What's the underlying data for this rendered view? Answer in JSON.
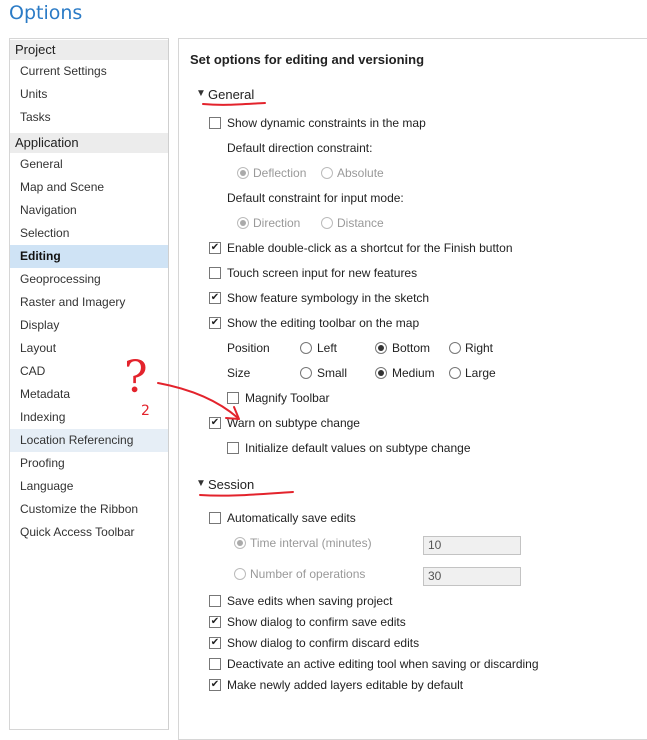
{
  "window": {
    "title": "Options"
  },
  "nav": {
    "groups": [
      {
        "label": "Project",
        "items": [
          "Current Settings",
          "Units",
          "Tasks"
        ]
      },
      {
        "label": "Application",
        "items": [
          "General",
          "Map and Scene",
          "Navigation",
          "Selection",
          "Editing",
          "Geoprocessing",
          "Raster and Imagery",
          "Display",
          "Layout",
          "CAD",
          "Metadata",
          "Indexing",
          "Location Referencing",
          "Proofing",
          "Language",
          "Customize the Ribbon",
          "Quick Access Toolbar"
        ]
      }
    ],
    "selected": "Editing",
    "hovered": "Location Referencing"
  },
  "panel": {
    "heading": "Set options for editing and versioning",
    "general": {
      "title": "General",
      "show_dynamic": {
        "label": "Show dynamic constraints in the map",
        "checked": false
      },
      "direction_label": "Default direction constraint:",
      "direction_opts": [
        "Deflection",
        "Absolute"
      ],
      "input_label": "Default constraint for input mode:",
      "input_opts": [
        "Direction",
        "Distance"
      ],
      "double_click": {
        "label": "Enable double-click as a shortcut for the Finish button",
        "checked": true
      },
      "touch": {
        "label": "Touch screen input for new features",
        "checked": false
      },
      "symbology": {
        "label": "Show feature symbology in the sketch",
        "checked": true
      },
      "toolbar": {
        "label": "Show the editing toolbar on the map",
        "checked": true
      },
      "position_label": "Position",
      "position_opts": [
        "Left",
        "Bottom",
        "Right"
      ],
      "size_label": "Size",
      "size_opts": [
        "Small",
        "Medium",
        "Large"
      ],
      "magnify": {
        "label": "Magnify Toolbar",
        "checked": false
      },
      "warn_subtype": {
        "label": "Warn on subtype change",
        "checked": true
      },
      "init_defaults": {
        "label": "Initialize default values on subtype change",
        "checked": false
      }
    },
    "session": {
      "title": "Session",
      "auto_save": {
        "label": "Automatically save edits",
        "checked": false
      },
      "time_interval": {
        "label": "Time interval (minutes)",
        "value": "10"
      },
      "num_operations": {
        "label": "Number of operations",
        "value": "30"
      },
      "save_project": {
        "label": "Save edits when saving project",
        "checked": false
      },
      "confirm_save": {
        "label": "Show dialog to confirm save edits",
        "checked": true
      },
      "confirm_discard": {
        "label": "Show dialog to confirm discard edits",
        "checked": true
      },
      "deactivate": {
        "label": "Deactivate an active editing tool when saving or discarding",
        "checked": false
      },
      "editable_layers": {
        "label": "Make newly added layers editable by default",
        "checked": true
      }
    }
  },
  "annotation": {
    "ink_color": "#e3232c",
    "scribble_text": "?",
    "scribble_note": "2"
  }
}
